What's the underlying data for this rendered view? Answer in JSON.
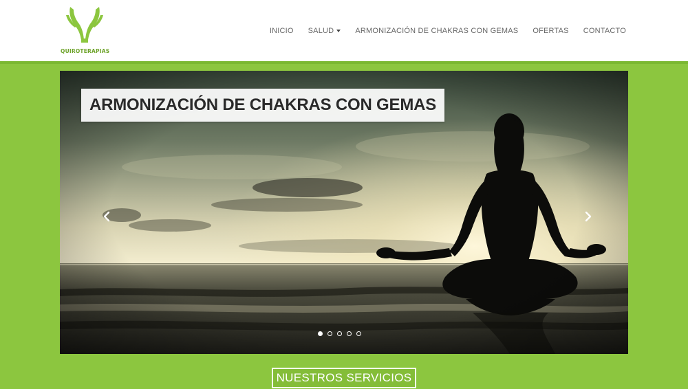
{
  "brand": {
    "name": "QUIROTERAPIAS",
    "logo_icon": "raised-hands-logo-icon",
    "color": "#8cc63f"
  },
  "nav": {
    "items": [
      {
        "label": "INICIO"
      },
      {
        "label": "SALUD",
        "dropdown": true
      },
      {
        "label": "ARMONIZACIÓN DE CHAKRAS CON GEMAS"
      },
      {
        "label": "OFERTAS"
      },
      {
        "label": "CONTACTO"
      }
    ]
  },
  "slider": {
    "caption": "ARMONIZACIÓN DE CHAKRAS CON GEMAS",
    "image": "silhouette of woman meditating in lotus pose by the sea at sunset",
    "prev_icon": "chevron-left-icon",
    "next_icon": "chevron-right-icon",
    "slide_count": 5,
    "active_slide": 1
  },
  "services": {
    "title": "NUESTROS SERVICIOS"
  }
}
